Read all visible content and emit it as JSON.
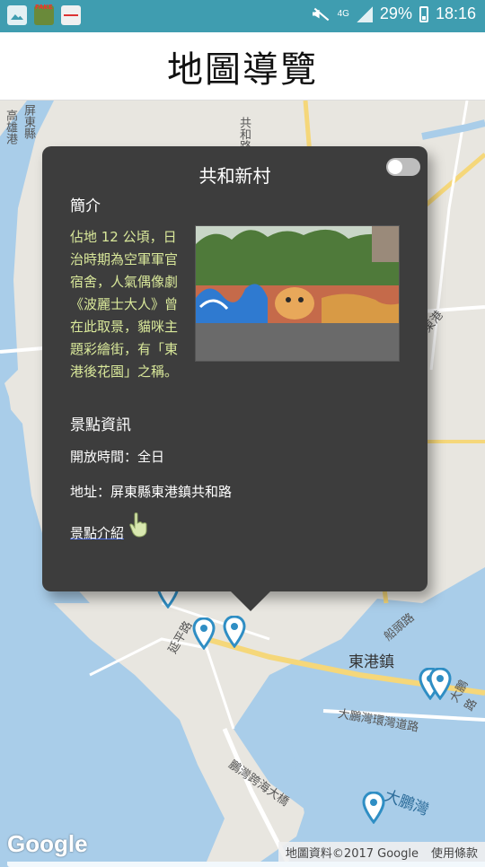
{
  "status_bar": {
    "battery": "29%",
    "time": "18:16",
    "network": "4G"
  },
  "header": {
    "title": "地圖導覽"
  },
  "map": {
    "street_labels": [
      "高雄港",
      "屏東縣",
      "共和路",
      "船頭路",
      "大鵬路",
      "延平路",
      "大鵬灣環灣道路",
      "鵬灣跨海大橋",
      "東港",
      "大鵬灣",
      "東港鎮"
    ],
    "google_logo": "Google",
    "attribution": "地圖資料©2017 Google",
    "terms": "使用條款"
  },
  "info_window": {
    "title": "共和新村",
    "intro_heading": "簡介",
    "intro_text": "佔地 12 公頃，日治時期為空軍軍官宿舍，人氣偶像劇《波麗士大人》曾在此取景，貓咪主題彩繪街，有「東港後花園」之稱。",
    "info_heading": "景點資訊",
    "hours": "開放時間：全日",
    "address": "地址：屏東縣東港鎮共和路",
    "link_text": "景點介紹"
  },
  "colors": {
    "status_bar": "#3f9db0",
    "info_window_bg": "#3d3d3d",
    "intro_text": "#d9e89a",
    "water": "#a9cde9",
    "land": "#e8e6e0",
    "pin": "#2f8ec4"
  }
}
